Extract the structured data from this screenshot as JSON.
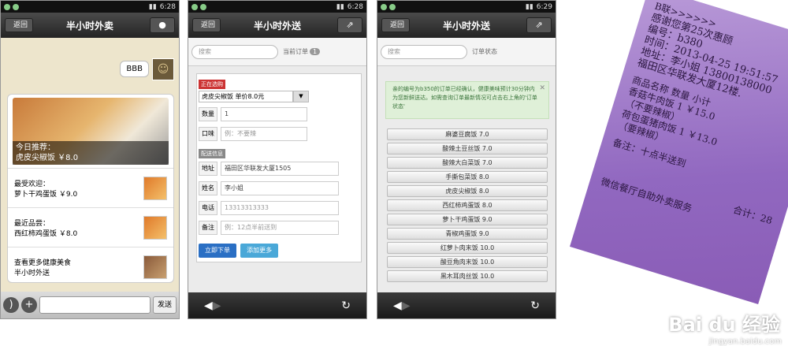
{
  "status1": {
    "time": "6:28"
  },
  "status2": {
    "time": "6:28"
  },
  "status3": {
    "time": "6:29"
  },
  "chat": {
    "back": "返回",
    "title": "半小时外卖",
    "user_icon": "person-icon",
    "my_msg": "BBB",
    "hero_line1": "今日推荐：",
    "hero_line2": "虎皮尖椒饭 ￥8.0",
    "items": [
      {
        "line1": "最受欢迎：",
        "line2": "萝卜干鸡蛋饭 ￥9.0"
      },
      {
        "line1": "最近品尝：",
        "line2": "西红柿鸡蛋饭 ￥8.0"
      },
      {
        "line1": "查看更多健康美食",
        "line2": "半小时外送"
      }
    ],
    "send": "发送"
  },
  "order": {
    "back": "返回",
    "title": "半小时外送",
    "search_placeholder": "搜索",
    "current_label": "当前订单",
    "current_count": "1",
    "selected_tag": "正在选购",
    "dish_select": "虎皮尖椒饭 单价8.0元",
    "qty_label": "数量",
    "qty_value": "1",
    "taste_label": "口味",
    "taste_ph": "例：不要辣",
    "delivery_tag": "配送信息",
    "addr_label": "地址",
    "addr_value": "福田区华联发大厦1505",
    "name_label": "姓名",
    "name_value": "李小姐",
    "phone_label": "电话",
    "phone_value": "13313313333",
    "note_label": "备注",
    "note_ph": "例：12点半前送到",
    "submit": "立即下单",
    "add_more": "添加更多"
  },
  "menu": {
    "back": "返回",
    "title": "半小时外送",
    "search_placeholder": "搜索",
    "status_label": "订单状态",
    "notice": "亲的编号为b350的订单已经确认，健康美味预计30分钟内为您新鲜送达。如需查询订单最新情况可点击右上角的'订单状态'",
    "items": [
      "麻婆豆腐饭 7.0",
      "酸辣土豆丝饭 7.0",
      "酸辣大白菜饭 7.0",
      "手撕包菜饭 8.0",
      "虎皮尖椒饭 8.0",
      "西红柿鸡蛋饭 8.0",
      "萝卜干鸡蛋饭 9.0",
      "青椒鸡蛋饭 9.0",
      "红萝卜肉末饭 10.0",
      "酸豆角肉末饭 10.0",
      "黑木耳肉丝饭 10.0"
    ]
  },
  "receipt": {
    "l1": "B联>>>>>>",
    "l2": "感谢您第25次惠顾",
    "l3": "编号：b380",
    "l4": "时间：2013-04-25 19:51:57",
    "l5": "地址：李小姐 13800138000",
    "l6": "福田区华联发大厦12楼.",
    "l7": "商品名称        数量  小计",
    "l8": "香菇牛肉饭        1  ￥15.0",
    "l9": "（不要辣椒）",
    "l10": "荷包蛋猪肉饭      1  ￥13.0",
    "l11": "（要辣椒）",
    "l12": "备注：十点半送到",
    "l13": "合计：28",
    "l14": "微信餐厅自助外卖服务",
    "wm": "Bai du 经验",
    "wm2": "jingyan.baidu.com"
  }
}
